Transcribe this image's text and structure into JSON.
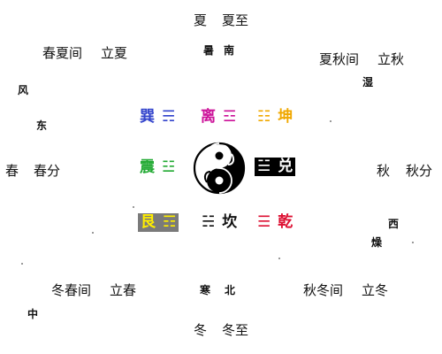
{
  "directions": {
    "south_top": {
      "season": "夏",
      "term": "夏至"
    },
    "south_sub": {
      "quality": "暑",
      "direction": "南"
    },
    "north_bottom": {
      "season": "冬",
      "term": "冬至"
    },
    "north_sub": {
      "quality": "寒",
      "direction": "北"
    },
    "east_left": {
      "season": "春",
      "term": "春分"
    },
    "east_sub": {
      "quality": "风",
      "direction": "东"
    },
    "west_right": {
      "season": "秋",
      "term": "秋分"
    },
    "west_sub": {
      "quality": "燥",
      "direction": "西"
    },
    "northwest_top_left": {
      "interval": "春夏间",
      "term": "立夏"
    },
    "northeast_top_right": {
      "interval": "夏秋间",
      "term": "立秋",
      "quality": "湿"
    },
    "southwest_bottom_left": {
      "interval": "冬春间",
      "term": "立春",
      "quality": "中"
    },
    "southeast_bottom_right": {
      "interval": "秋冬间",
      "term": "立冬"
    }
  },
  "trigrams": {
    "xun": {
      "name": "巽",
      "symbol": "☴",
      "color": "#3344cc"
    },
    "li": {
      "name": "离",
      "symbol": "☲",
      "color": "#cc1199"
    },
    "kun": {
      "name": "坤",
      "symbol": "☷",
      "color": "#f0a800"
    },
    "zhen": {
      "name": "震",
      "symbol": "☳",
      "color": "#22aa33"
    },
    "dui": {
      "name": "兑",
      "symbol": "☱",
      "color": "#ffffff",
      "background": "#000000"
    },
    "gen": {
      "name": "艮",
      "symbol": "☶",
      "color": "#ffee00",
      "background": "#7a7a7a"
    },
    "kan": {
      "name": "坎",
      "symbol": "☵",
      "color": "#111111"
    },
    "qian": {
      "name": "乾",
      "symbol": "☰",
      "color": "#dd1133"
    }
  }
}
